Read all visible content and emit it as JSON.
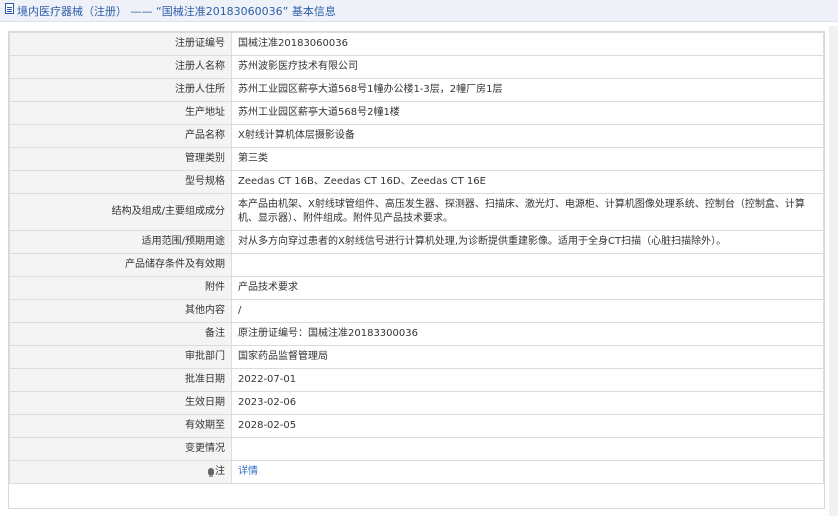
{
  "header": {
    "title": "境内医疗器械（注册） —— “国械注准20183060036” 基本信息"
  },
  "rows": [
    {
      "label": "注册证编号",
      "value": "国械注准20183060036"
    },
    {
      "label": "注册人名称",
      "value": "苏州波影医疗技术有限公司"
    },
    {
      "label": "注册人住所",
      "value": "苏州工业园区薪亭大道568号1幢办公楼1-3层，2幢厂房1层"
    },
    {
      "label": "生产地址",
      "value": "苏州工业园区薪亭大道568号2幢1楼"
    },
    {
      "label": "产品名称",
      "value": "X射线计算机体层摄影设备"
    },
    {
      "label": "管理类别",
      "value": "第三类"
    },
    {
      "label": "型号规格",
      "value": "Zeedas CT 16B、Zeedas CT 16D、Zeedas CT 16E"
    },
    {
      "label": "结构及组成/主要组成成分",
      "value": "本产品由机架、X射线球管组件、高压发生器、探测器、扫描床、激光灯、电源柜、计算机图像处理系统、控制台（控制盒、计算机、显示器）、附件组成。附件见产品技术要求。"
    },
    {
      "label": "适用范围/预期用途",
      "value": "对从多方向穿过患者的X射线信号进行计算机处理,为诊断提供重建影像。适用于全身CT扫描（心脏扫描除外）。"
    },
    {
      "label": "产品储存条件及有效期",
      "value": ""
    },
    {
      "label": "附件",
      "value": "产品技术要求"
    },
    {
      "label": "其他内容",
      "value": "/"
    },
    {
      "label": "备注",
      "value": "原注册证编号：国械注准20183300036"
    },
    {
      "label": "审批部门",
      "value": "国家药品监督管理局"
    },
    {
      "label": "批准日期",
      "value": "2022-07-01"
    },
    {
      "label": "生效日期",
      "value": "2023-02-06"
    },
    {
      "label": "有效期至",
      "value": "2028-02-05"
    },
    {
      "label": "变更情况",
      "value": ""
    }
  ],
  "note_row": {
    "label": "注",
    "link": "详情",
    "icon": "lightbulb-icon"
  }
}
